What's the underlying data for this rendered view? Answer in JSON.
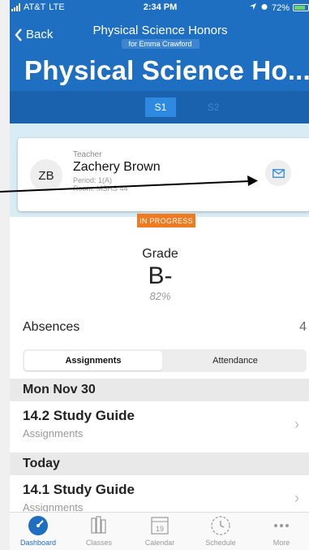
{
  "status_bar": {
    "carrier": "AT&T",
    "network": "LTE",
    "time": "2:34 PM",
    "battery": "72%"
  },
  "nav": {
    "back_label": "Back",
    "title": "Physical Science Honors",
    "subtitle": "for Emma Crawford"
  },
  "page": {
    "big_title": "Physical Science Ho..."
  },
  "terms": [
    {
      "label": "S1",
      "selected": true
    },
    {
      "label": "S2",
      "selected": false
    }
  ],
  "teacher": {
    "initials": "ZB",
    "role": "Teacher",
    "name": "Zachery Brown",
    "period": "Period: 1(A)",
    "room": "Room: MSHS 44"
  },
  "grade": {
    "status": "IN PROGRESS",
    "label": "Grade",
    "letter": "B-",
    "percent": "82%"
  },
  "absences": {
    "label": "Absences",
    "count": "4"
  },
  "segmented": {
    "assignments": "Assignments",
    "attendance": "Attendance"
  },
  "sections": [
    {
      "header": "Mon Nov 30",
      "items": [
        {
          "title": "14.2 Study Guide",
          "subtitle": "Assignments"
        }
      ]
    },
    {
      "header": "Today",
      "items": [
        {
          "title": "14.1 Study Guide",
          "subtitle": "Assignments"
        }
      ]
    }
  ],
  "tab_bar": {
    "items": [
      {
        "label": "Dashboard",
        "icon": "dashboard-icon"
      },
      {
        "label": "Classes",
        "icon": "classes-icon"
      },
      {
        "label": "Calendar",
        "icon": "calendar-icon",
        "icon_text": "19"
      },
      {
        "label": "Schedule",
        "icon": "schedule-icon"
      },
      {
        "label": "More",
        "icon": "more-icon"
      }
    ]
  },
  "colors": {
    "header": "#1e6fc2",
    "accent": "#f07a1f",
    "teacher_bg": "#d7ecf5"
  }
}
